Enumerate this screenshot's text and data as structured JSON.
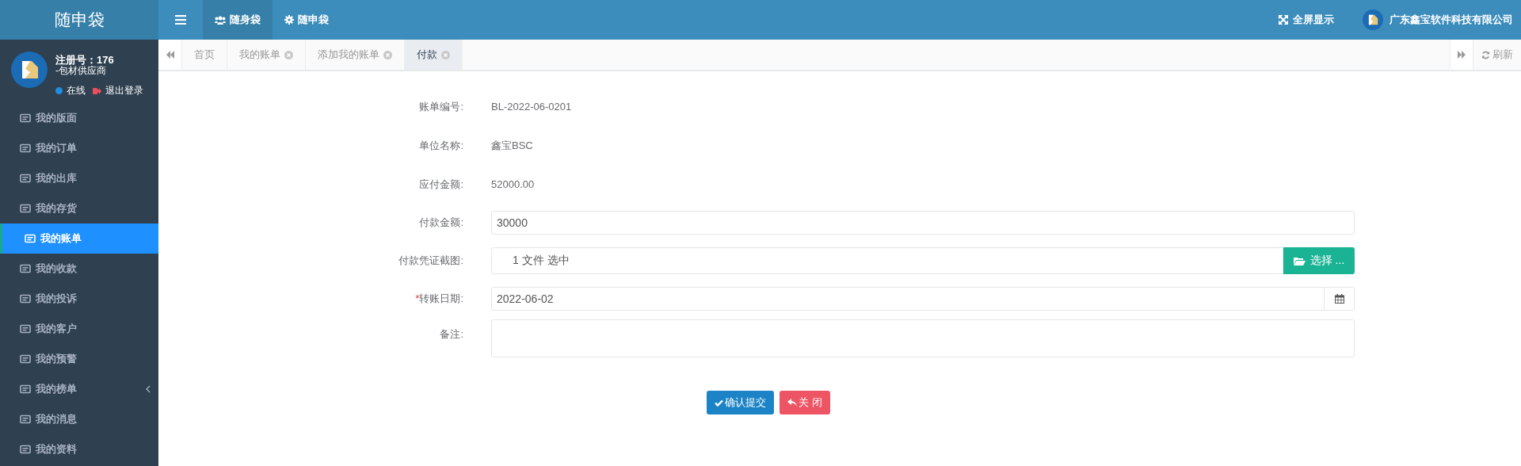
{
  "brand": {
    "title": "随申袋"
  },
  "user": {
    "reg": "注册号：176",
    "role": "-包材供应商",
    "status": "在线",
    "logout": "退出登录"
  },
  "sidebar": {
    "items": [
      {
        "label": "我的版面",
        "selected": false,
        "expandable": false
      },
      {
        "label": "我的订单",
        "selected": false,
        "expandable": false
      },
      {
        "label": "我的出库",
        "selected": false,
        "expandable": false
      },
      {
        "label": "我的存货",
        "selected": false,
        "expandable": false
      },
      {
        "label": "我的账单",
        "selected": true,
        "expandable": false
      },
      {
        "label": "我的收款",
        "selected": false,
        "expandable": false
      },
      {
        "label": "我的投诉",
        "selected": false,
        "expandable": false
      },
      {
        "label": "我的客户",
        "selected": false,
        "expandable": false
      },
      {
        "label": "我的预警",
        "selected": false,
        "expandable": false
      },
      {
        "label": "我的榜单",
        "selected": false,
        "expandable": true
      },
      {
        "label": "我的消息",
        "selected": false,
        "expandable": false
      },
      {
        "label": "我的资料",
        "selected": false,
        "expandable": false
      }
    ]
  },
  "topbar": {
    "nav": [
      {
        "label": "随身袋",
        "selected": true
      },
      {
        "label": "随申袋",
        "selected": false
      }
    ],
    "fullscreen": "全屏显示",
    "company": "广东鑫宝软件科技有限公司"
  },
  "tabs": {
    "items": [
      {
        "label": "首页",
        "selected": false,
        "closable": false
      },
      {
        "label": "我的账单",
        "selected": false,
        "closable": true
      },
      {
        "label": "添加我的账单",
        "selected": false,
        "closable": true
      },
      {
        "label": "付款",
        "selected": true,
        "closable": true
      }
    ],
    "refresh": "刷新"
  },
  "form": {
    "rows": [
      {
        "kind": "text",
        "label": "账单编号:",
        "value": "BL-2022-06-0201"
      },
      {
        "kind": "text",
        "label": "单位名称:",
        "value": "鑫宝BSC"
      },
      {
        "kind": "text",
        "label": "应付金额:",
        "value": "52000.00"
      },
      {
        "kind": "input",
        "label": "付款金额:",
        "value": "30000"
      },
      {
        "kind": "file",
        "label": "付款凭证截图:",
        "value": "1 文件 选中",
        "button": "选择 ..."
      },
      {
        "kind": "date",
        "label": "转账日期:",
        "required_mark": "*",
        "value": "2022-06-02"
      },
      {
        "kind": "textarea",
        "label": "备注:"
      }
    ],
    "buttons": [
      {
        "kind": "primary",
        "label": "确认提交"
      },
      {
        "kind": "danger",
        "label": "关 闭"
      }
    ]
  }
}
